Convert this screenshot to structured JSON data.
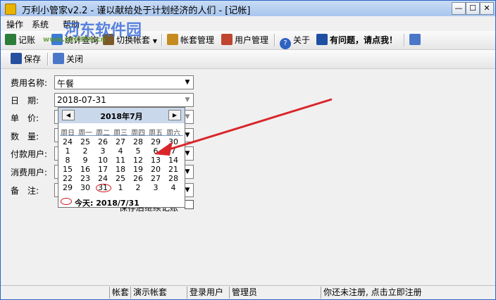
{
  "window": {
    "title": "万利小管家v2.2 - 谨以献给处于计划经济的人们 - [记帐]",
    "min_label": "—",
    "max_label": "☐",
    "close_label": "✕"
  },
  "menubar": {
    "items": [
      "操作",
      "系统",
      "帮助"
    ]
  },
  "toolbar": {
    "record_label": "记账",
    "stats_label": "统计查询",
    "switch_label": "切换帐套",
    "account_manage_label": "帐套管理",
    "user_manage_label": "用户管理",
    "about_label": "关于",
    "help_label": "有问题，请点我！"
  },
  "subtoolbar": {
    "save_label": "保存",
    "close_label": "关闭"
  },
  "form": {
    "expense_name_label": "费用名称:",
    "expense_name_value": "午餐",
    "date_label": "日　期:",
    "date_value": "2018-07-31",
    "unit_price_label": "单　价:",
    "quantity_label": "数　量:",
    "payer_label": "付款用户:",
    "consumer_label": "消费用户:",
    "note_label": "备　注:",
    "hidden_checkbox_label": "保存后继续记账"
  },
  "calendar": {
    "month_title": "2018年7月",
    "prev_label": "◀",
    "next_label": "▶",
    "weekdays": [
      "周日",
      "周一",
      "周二",
      "周三",
      "周四",
      "周五",
      "周六"
    ],
    "weeks": [
      [
        "24",
        "25",
        "26",
        "27",
        "28",
        "29",
        "30"
      ],
      [
        "1",
        "2",
        "3",
        "4",
        "5",
        "6",
        "7"
      ],
      [
        "8",
        "9",
        "10",
        "11",
        "12",
        "13",
        "14"
      ],
      [
        "15",
        "16",
        "17",
        "18",
        "19",
        "20",
        "21"
      ],
      [
        "22",
        "23",
        "24",
        "25",
        "26",
        "27",
        "28"
      ],
      [
        "29",
        "30",
        "31",
        "1",
        "2",
        "3",
        "4"
      ]
    ],
    "today_text": "今天: 2018/7/31"
  },
  "statusbar": {
    "account_label": "帐套",
    "account_value": "演示帐套",
    "login_label": "登录用户",
    "login_value": "管理员",
    "register_text": "你还未注册, 点击立即注册"
  },
  "watermark": {
    "name": "河东软件园",
    "url": "www.pc0359.cn"
  },
  "colors": {
    "arrow": "#d9262b",
    "calendar_header": "#c9d8ea",
    "title_bar": "#b9d1f0"
  }
}
